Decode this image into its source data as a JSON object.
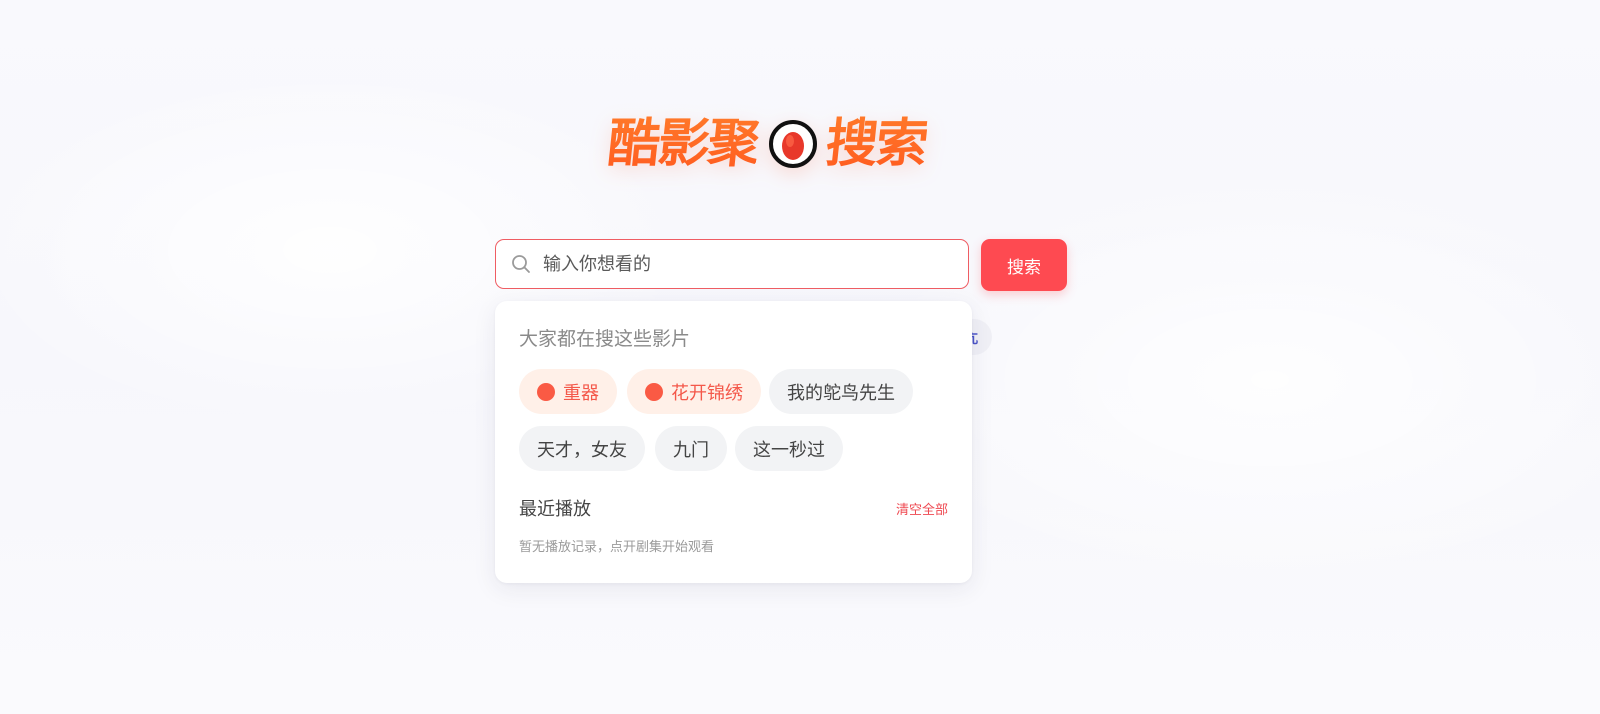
{
  "logo": {
    "text_left": "酷影聚",
    "text_right": "搜索",
    "icon": "red-egg-circle-icon"
  },
  "search": {
    "placeholder": "输入你想看的",
    "value": "",
    "button_label": "搜索",
    "icon": "search-icon"
  },
  "background_tag": {
    "visible_text": "亢"
  },
  "hot": {
    "title": "大家都在搜这些影片",
    "items": [
      {
        "label": "重器",
        "hot": true
      },
      {
        "label": "花开锦绣",
        "hot": true
      },
      {
        "label": "我的鸵鸟先生",
        "hot": false
      },
      {
        "label": "天才，女友",
        "hot": false
      },
      {
        "label": "九门",
        "hot": false
      },
      {
        "label": "这一秒过",
        "hot": false
      }
    ]
  },
  "recent": {
    "title": "最近播放",
    "clear_label": "清空全部",
    "empty_text": "暂无播放记录，点开剧集开始观看"
  },
  "colors": {
    "accent": "#fe4a51",
    "logo_orange": "#ff6a24",
    "hot_chip_bg": "#fff0e8",
    "chip_bg": "#f2f3f5"
  }
}
